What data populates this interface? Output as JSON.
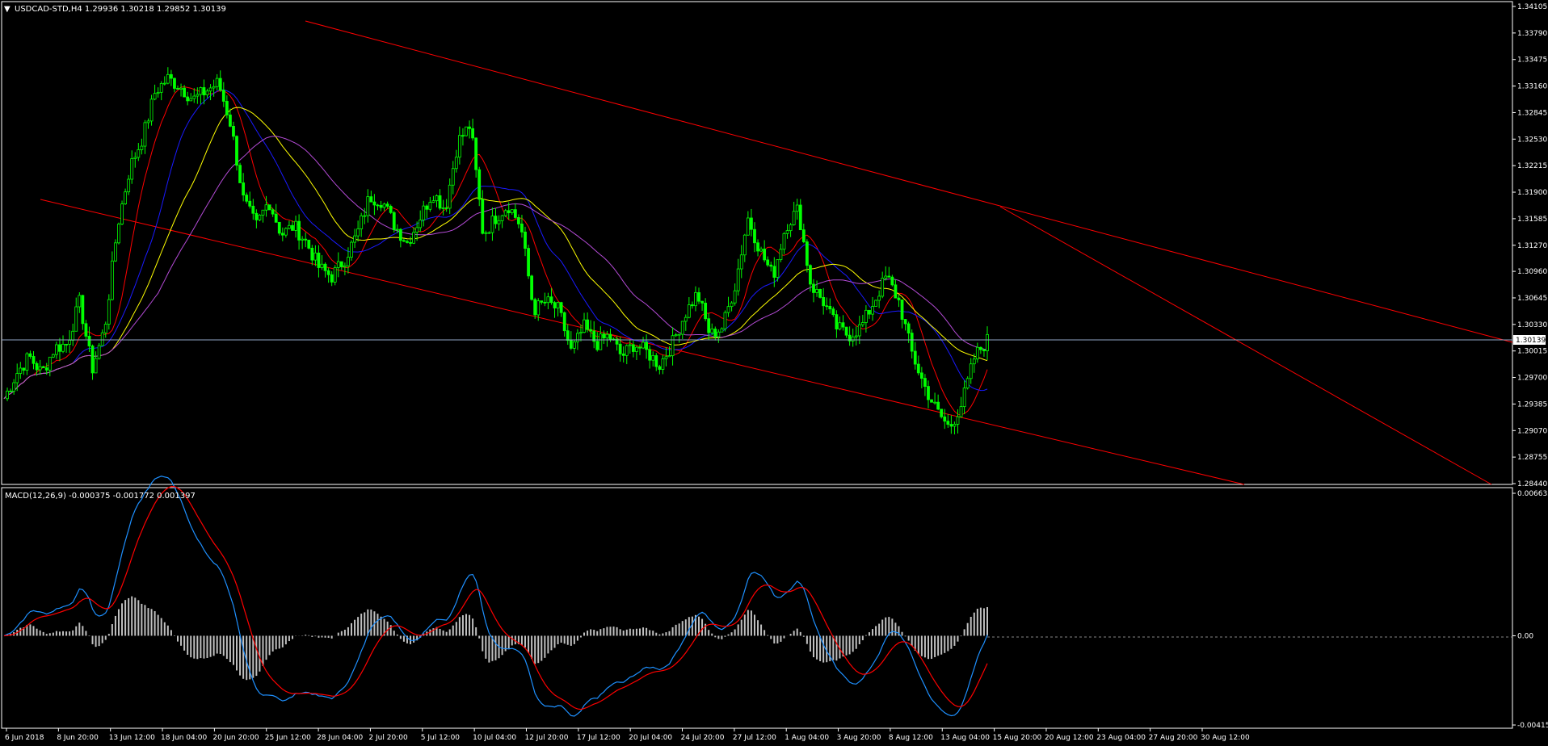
{
  "header": {
    "symbol_line": "USDCAD-STD,H4  1.29936 1.30218 1.29852 1.30139",
    "macd_line": "MACD(12,26,9) -0.000375 -0.001772 0.001397"
  },
  "colors": {
    "background": "#000000",
    "axis": "#ffffff",
    "candle": "#00ff00",
    "channel_lines": "#ff0000",
    "ma_red": "#ff0000",
    "ma_blue": "#1a1aff",
    "ma_yellow": "#ffff00",
    "ma_violet": "#b44bd6",
    "macd_line": "#1e90ff",
    "signal_line": "#ff0000",
    "histogram": "#c0c0c0",
    "current_price_line": "#8fa3c4"
  },
  "chart_data": [
    {
      "type": "candlestick",
      "symbol": "USDCAD-STD",
      "timeframe": "H4",
      "ohlc": {
        "open": 1.29936,
        "high": 1.30218,
        "low": 1.29852,
        "close": 1.30139
      },
      "current_price": "1.30139",
      "y_ticks": [
        "1.34105",
        "1.33790",
        "1.33475",
        "1.33160",
        "1.32845",
        "1.32530",
        "1.32215",
        "1.31900",
        "1.31585",
        "1.31270",
        "1.30960",
        "1.30645",
        "1.30330",
        "1.30015",
        "1.29700",
        "1.29385",
        "1.29070",
        "1.28755",
        "1.28440"
      ],
      "ylim": [
        1.2844,
        1.34105
      ],
      "x_ticks": [
        "6 Jun 2018",
        "8 Jun 20:00",
        "13 Jun 12:00",
        "18 Jun 04:00",
        "20 Jun 20:00",
        "25 Jun 12:00",
        "28 Jun 04:00",
        "2 Jul 20:00",
        "5 Jul 12:00",
        "10 Jul 04:00",
        "12 Jul 20:00",
        "17 Jul 12:00",
        "20 Jul 04:00",
        "24 Jul 20:00",
        "27 Jul 12:00",
        "1 Aug 04:00",
        "3 Aug 20:00",
        "8 Aug 12:00",
        "13 Aug 04:00",
        "15 Aug 20:00",
        "20 Aug 12:00",
        "23 Aug 04:00",
        "27 Aug 20:00",
        "30 Aug 12:00"
      ],
      "close_path": [
        [
          0,
          1.2945
        ],
        [
          1,
          1.2975
        ],
        [
          2,
          1.2995
        ],
        [
          3,
          1.2975
        ],
        [
          4,
          1.3005
        ],
        [
          5,
          1.301
        ],
        [
          6,
          1.306
        ],
        [
          7,
          1.298
        ],
        [
          8,
          1.303
        ],
        [
          9,
          1.315
        ],
        [
          10,
          1.322
        ],
        [
          11,
          1.3255
        ],
        [
          12,
          1.331
        ],
        [
          13,
          1.3325
        ],
        [
          14,
          1.3315
        ],
        [
          15,
          1.33
        ],
        [
          16,
          1.331
        ],
        [
          17,
          1.332
        ],
        [
          18,
          1.327
        ],
        [
          19,
          1.318
        ],
        [
          20,
          1.315
        ],
        [
          21,
          1.318
        ],
        [
          22,
          1.314
        ],
        [
          23,
          1.315
        ],
        [
          24,
          1.313
        ],
        [
          25,
          1.31
        ],
        [
          26,
          1.309
        ],
        [
          27,
          1.311
        ],
        [
          28,
          1.314
        ],
        [
          29,
          1.3185
        ],
        [
          30,
          1.318
        ],
        [
          31,
          1.315
        ],
        [
          32,
          1.313
        ],
        [
          33,
          1.316
        ],
        [
          34,
          1.319
        ],
        [
          35,
          1.317
        ],
        [
          36,
          1.325
        ],
        [
          37,
          1.327
        ],
        [
          38,
          1.314
        ],
        [
          39,
          1.316
        ],
        [
          40,
          1.3175
        ],
        [
          41,
          1.315
        ],
        [
          42,
          1.305
        ],
        [
          43,
          1.306
        ],
        [
          44,
          1.305
        ],
        [
          45,
          1.3
        ],
        [
          46,
          1.303
        ],
        [
          47,
          1.301
        ],
        [
          48,
          1.302
        ],
        [
          49,
          1.2995
        ],
        [
          50,
          1.301
        ],
        [
          51,
          1.3
        ],
        [
          52,
          1.2985
        ],
        [
          53,
          1.301
        ],
        [
          54,
          1.3045
        ],
        [
          55,
          1.307
        ],
        [
          56,
          1.302
        ],
        [
          57,
          1.303
        ],
        [
          58,
          1.308
        ],
        [
          59,
          1.316
        ],
        [
          60,
          1.312
        ],
        [
          61,
          1.309
        ],
        [
          62,
          1.315
        ],
        [
          63,
          1.317
        ],
        [
          64,
          1.308
        ],
        [
          65,
          1.306
        ],
        [
          66,
          1.303
        ],
        [
          67,
          1.302
        ],
        [
          68,
          1.303
        ],
        [
          69,
          1.306
        ],
        [
          70,
          1.309
        ],
        [
          71,
          1.306
        ],
        [
          72,
          1.3
        ],
        [
          73,
          1.296
        ],
        [
          74,
          1.293
        ],
        [
          75,
          1.291
        ],
        [
          76,
          1.294
        ],
        [
          77,
          1.2995
        ],
        [
          78,
          1.3014
        ]
      ]
    },
    {
      "type": "line",
      "name": "MACD(12,26,9)",
      "values_text": "-0.000375 -0.001772 0.001397",
      "y_ticks": [
        "0.006635",
        "0.00",
        "-0.004156"
      ],
      "ylim": [
        -0.004156,
        0.006635
      ]
    }
  ]
}
